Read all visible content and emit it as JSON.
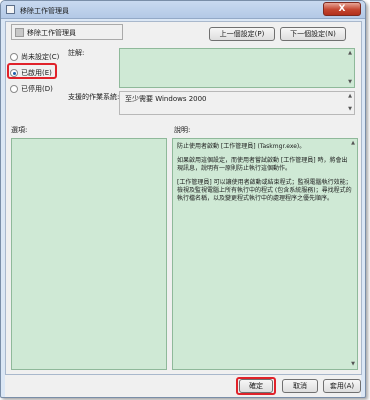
{
  "window": {
    "title": "移除工作管理員",
    "close_label": "X"
  },
  "header": {
    "title": "移除工作管理員"
  },
  "nav": {
    "prev_label": "上一個設定(P)",
    "next_label": "下一個設定(N)"
  },
  "options": [
    {
      "label": "尚未設定(C)",
      "selected": false
    },
    {
      "label": "已啟用(E)",
      "selected": true
    },
    {
      "label": "已停用(D)",
      "selected": false
    }
  ],
  "comment": {
    "label": "註解:",
    "value": ""
  },
  "supported": {
    "label": "支援的作業系統:",
    "value": "至少需要 Windows 2000"
  },
  "options_label": "選項:",
  "help": {
    "label": "說明:",
    "paragraphs": [
      "防止使用者啟動 [工作管理員] (Taskmgr.exe)。",
      "如果啟用這個設定，而使用者嘗試啟動 [工作管理員] 時，將會出現訊息，說明有一原則防止執行這個動作。",
      "[工作管理員] 可以讓使用者啟動或結束程式；監視電腦執行效能；檢視及監視電腦上所有執行中的程式 (包含系統服務)；尋找程式的執行檔名稱，以及變更程式執行中的處理程序之優先順序。"
    ]
  },
  "footer": {
    "ok_label": "確定",
    "cancel_label": "取消",
    "apply_label": "套用(A)"
  },
  "colors": {
    "highlight": "#e0222a",
    "pane_green": "#cfe9d5"
  }
}
